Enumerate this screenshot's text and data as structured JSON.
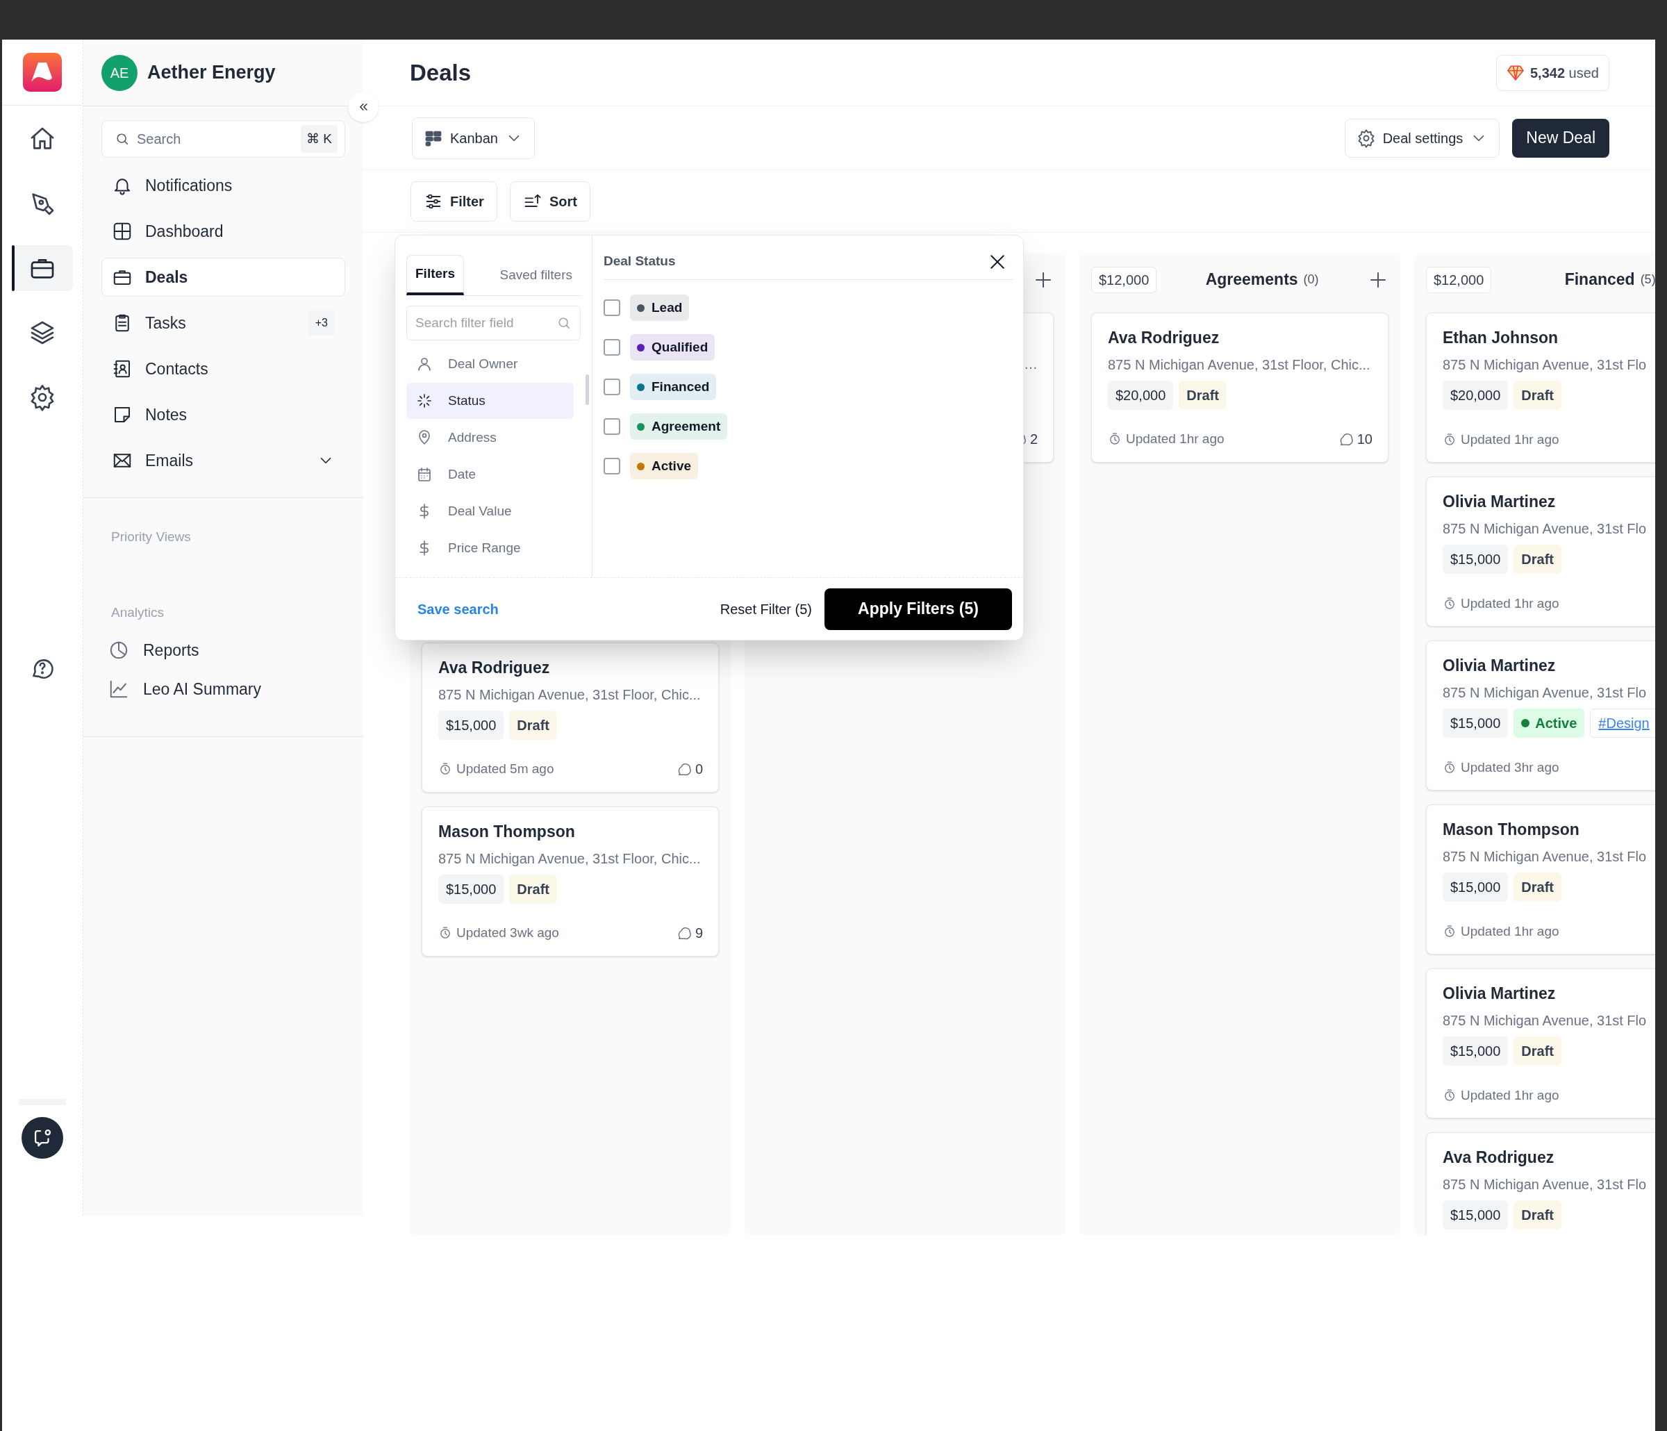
{
  "rail": {
    "items": [
      {
        "selected": false
      },
      {
        "selected": false
      },
      {
        "selected": true
      },
      {
        "selected": false
      },
      {
        "selected": false
      }
    ]
  },
  "sidebar": {
    "workspace": {
      "initials": "AE",
      "name": "Aether Energy"
    },
    "search": {
      "placeholder": "Search",
      "shortcut": "⌘ K"
    },
    "items": [
      {
        "label": "Notifications",
        "selected": false,
        "kind": "link"
      },
      {
        "label": "Dashboard",
        "selected": false,
        "kind": "link"
      },
      {
        "label": "Deals",
        "selected": true,
        "kind": "link"
      },
      {
        "label": "Tasks",
        "selected": false,
        "kind": "link",
        "badge": "+3"
      },
      {
        "label": "Contacts",
        "selected": false,
        "kind": "link"
      },
      {
        "label": "Notes",
        "selected": false,
        "kind": "link"
      },
      {
        "label": "Emails",
        "selected": false,
        "kind": "group"
      }
    ],
    "sections": [
      {
        "title": "Priority Views"
      },
      {
        "title": "Analytics",
        "items": [
          {
            "label": "Reports"
          },
          {
            "label": "Leo AI Summary"
          }
        ]
      }
    ]
  },
  "header": {
    "title": "Deals",
    "usage": {
      "count": "5,342",
      "label": "used"
    }
  },
  "toolbar": {
    "view": "Kanban",
    "settings": "Deal settings",
    "new_button": "New Deal"
  },
  "filter_bar": {
    "filter": "Filter",
    "sort": "Sort"
  },
  "board": {
    "columns": [
      {
        "kind": "covered",
        "cards": [
          {
            "name": "Ava Rodriguez",
            "address": "875 N Michigan Avenue, 31st Floor, Chic...",
            "value": "$15,000",
            "status": {
              "label": "Draft",
              "kind": "draft"
            },
            "updated": "Updated 5m ago",
            "comments": "0"
          },
          {
            "name": "Mason Thompson",
            "address": "875 N Michigan Avenue, 31st Floor, Chic...",
            "value": "$15,000",
            "status": {
              "label": "Draft",
              "kind": "draft"
            },
            "updated": "Updated 3wk ago",
            "comments": "9"
          }
        ]
      },
      {
        "kind": "partial",
        "add": true,
        "cards": [
          {
            "address": "…",
            "comments": "2"
          }
        ]
      },
      {
        "kind": "full",
        "value": "$12,000",
        "title": "Agreements",
        "count": "(0)",
        "add": true,
        "cards": [
          {
            "name": "Ava Rodriguez",
            "address": "875 N Michigan Avenue, 31st Floor, Chic...",
            "value": "$20,000",
            "status": {
              "label": "Draft",
              "kind": "draft"
            },
            "updated": "Updated 1hr ago",
            "comments": "10"
          }
        ]
      },
      {
        "kind": "full",
        "value": "$12,000",
        "title": "Financed",
        "count": "(5)",
        "cards": [
          {
            "name": "Ethan Johnson",
            "address": "875 N Michigan Avenue, 31st Flo",
            "value": "$20,000",
            "status": {
              "label": "Draft",
              "kind": "draft"
            },
            "updated": "Updated 1hr ago"
          },
          {
            "name": "Olivia Martinez",
            "address": "875 N Michigan Avenue, 31st Flo",
            "value": "$15,000",
            "status": {
              "label": "Draft",
              "kind": "draft"
            },
            "updated": "Updated 1hr ago"
          },
          {
            "name": "Olivia Martinez",
            "address": "875 N Michigan Avenue, 31st Flo",
            "value": "$15,000",
            "status": {
              "label": "Active",
              "kind": "active"
            },
            "tag": "#Design",
            "updated": "Updated 3hr ago"
          },
          {
            "name": "Mason Thompson",
            "address": "875 N Michigan Avenue, 31st Flo",
            "value": "$15,000",
            "status": {
              "label": "Draft",
              "kind": "draft"
            },
            "updated": "Updated 1hr ago"
          },
          {
            "name": "Olivia Martinez",
            "address": "875 N Michigan Avenue, 31st Flo",
            "value": "$15,000",
            "status": {
              "label": "Draft",
              "kind": "draft"
            },
            "updated": "Updated 1hr ago"
          },
          {
            "name": "Ava Rodriguez",
            "address": "875 N Michigan Avenue, 31st Flo",
            "value": "$15,000",
            "status": {
              "label": "Draft",
              "kind": "draft"
            }
          }
        ]
      }
    ]
  },
  "filter_popup": {
    "tabs": [
      {
        "label": "Filters",
        "selected": true
      },
      {
        "label": "Saved filters",
        "selected": false
      }
    ],
    "search": {
      "placeholder": "Search filter field"
    },
    "fields": [
      {
        "label": "Deal Owner",
        "selected": false
      },
      {
        "label": "Status",
        "selected": true
      },
      {
        "label": "Address",
        "selected": false
      },
      {
        "label": "Date",
        "selected": false
      },
      {
        "label": "Deal Value",
        "selected": false
      },
      {
        "label": "Price Range",
        "selected": false
      }
    ],
    "panel_title": "Deal Status",
    "options": [
      {
        "label": "Lead",
        "checked": false,
        "color": "#4b5563"
      },
      {
        "label": "Qualified",
        "checked": false,
        "color": "#5b21b6"
      },
      {
        "label": "Financed",
        "checked": false,
        "color": "#0e7490"
      },
      {
        "label": "Agreement",
        "checked": false,
        "color": "#15935a"
      },
      {
        "label": "Active",
        "checked": false,
        "color": "#c27803"
      }
    ],
    "save": "Save search",
    "reset": "Reset Filter (5)",
    "apply": "Apply Filters (5)"
  }
}
